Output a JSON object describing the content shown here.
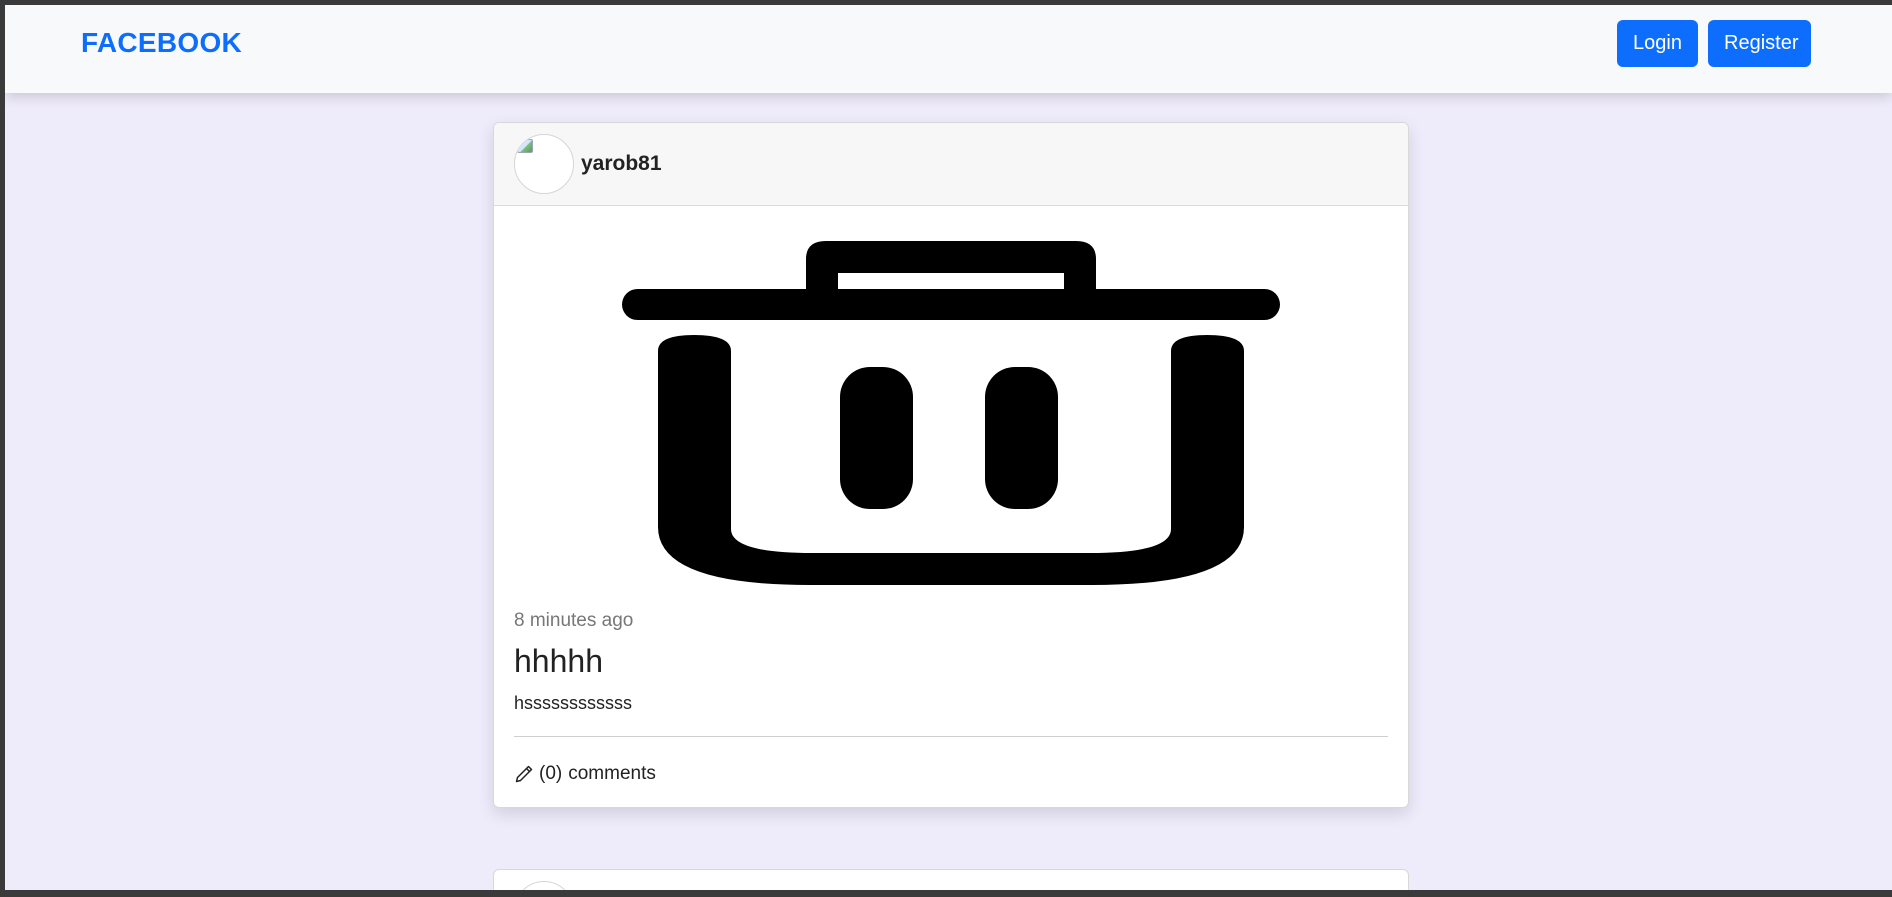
{
  "navbar": {
    "brand": "FACEBOOK",
    "login_label": "Login",
    "register_label": "Register"
  },
  "posts": [
    {
      "author": "yarob81",
      "time_ago": "8 minutes ago",
      "title": "hhhhh",
      "body": "hssssssssssss",
      "comments_count": "(0)",
      "comments_label": "comments",
      "image_icon": "trash-icon"
    }
  ],
  "colors": {
    "accent": "#0d6efd",
    "page_background": "#eeebfb",
    "navbar_background": "#f8f9fa"
  }
}
